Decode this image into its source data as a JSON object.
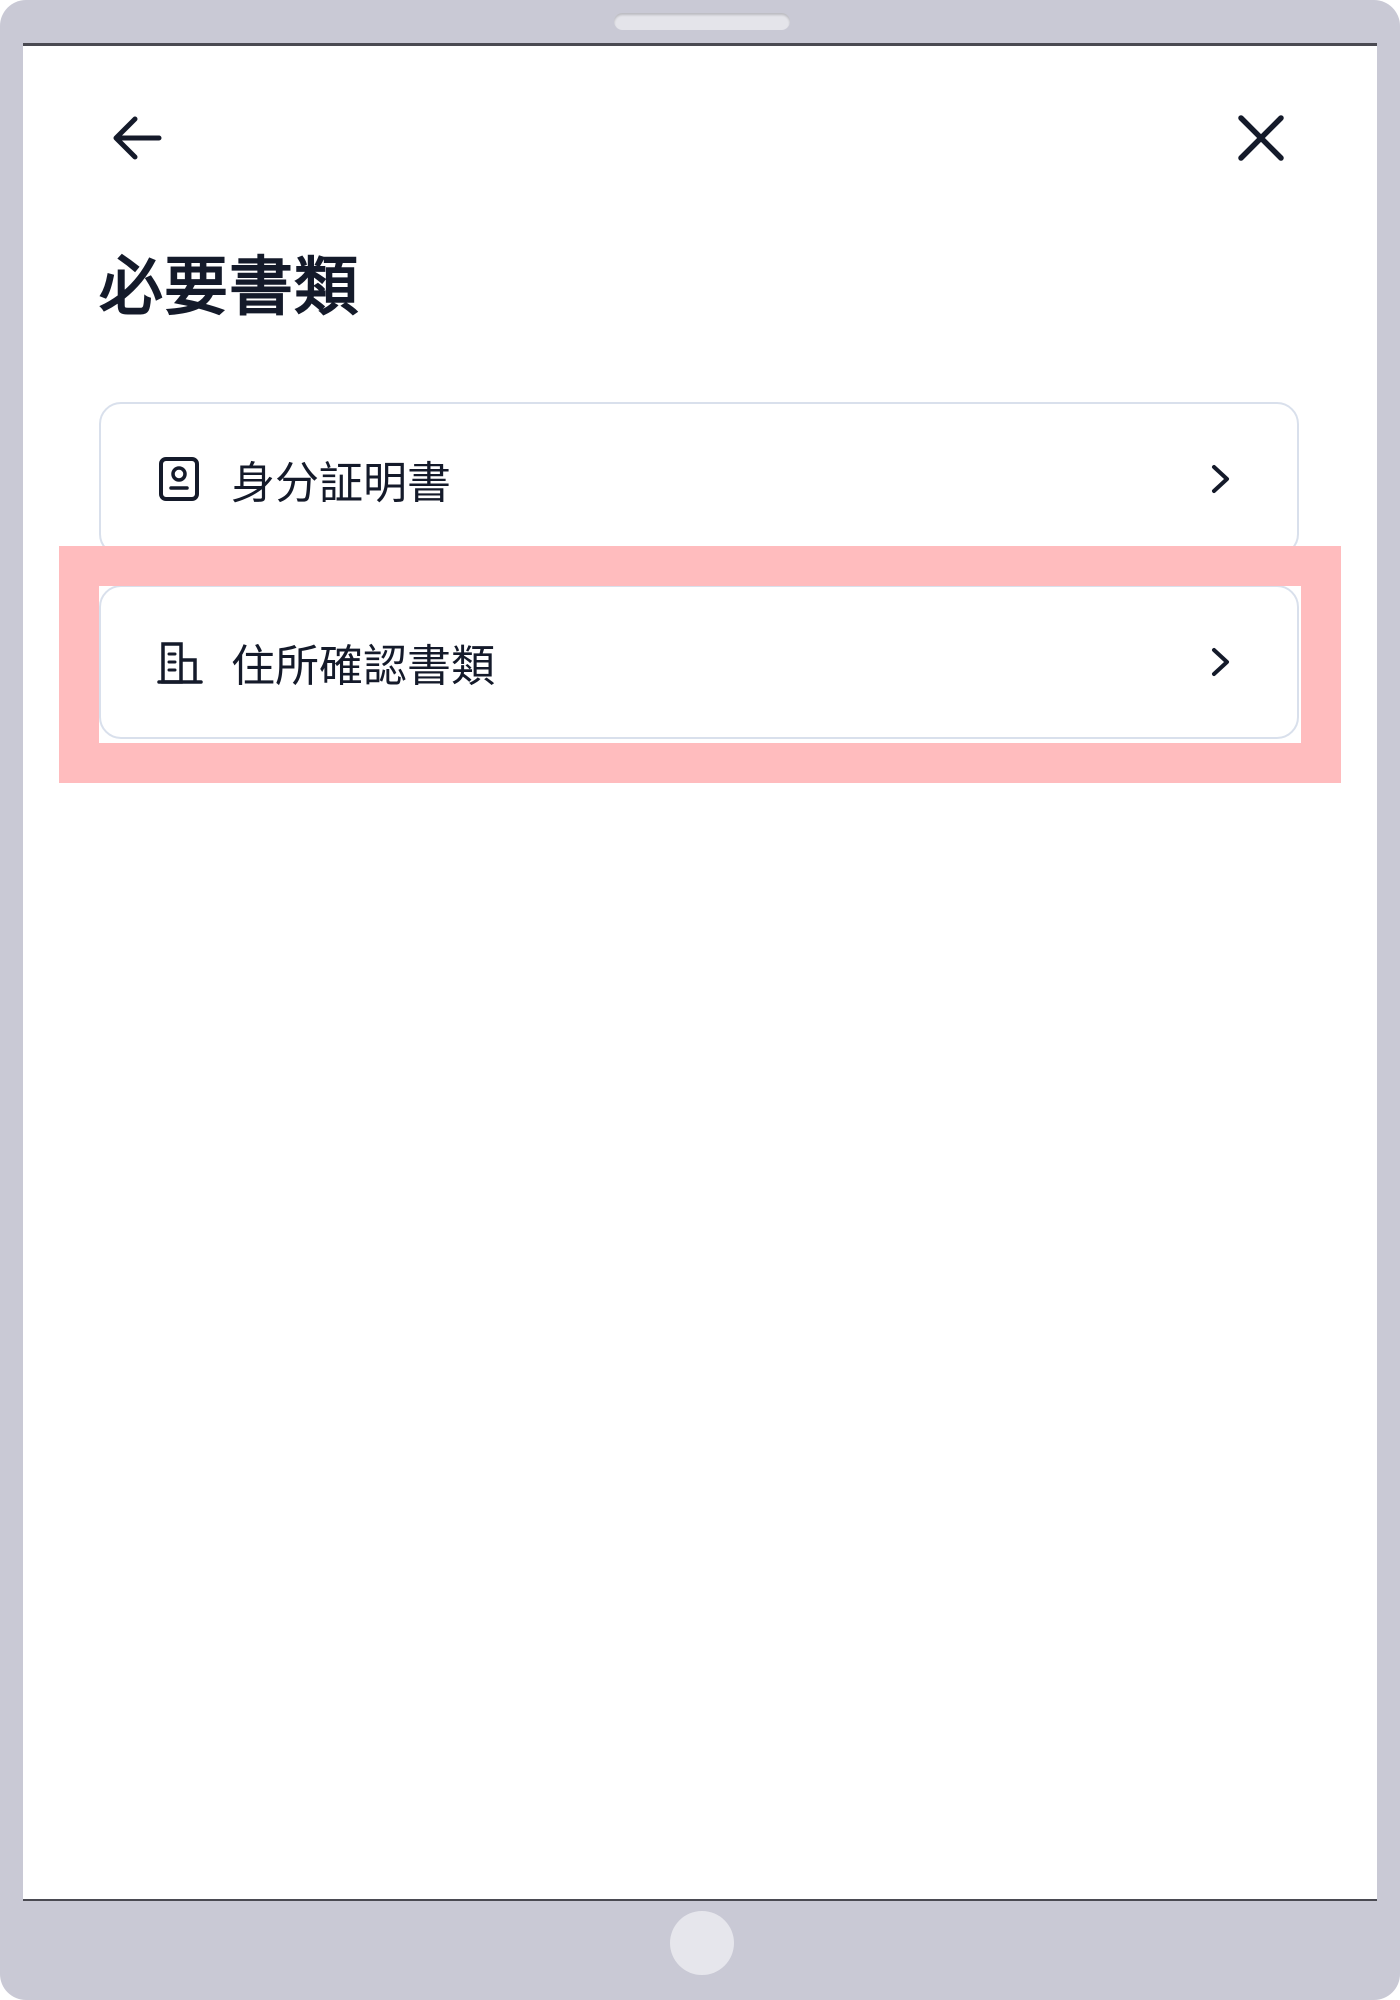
{
  "header": {
    "back_icon": "arrow-left-icon",
    "close_icon": "close-icon"
  },
  "page": {
    "title": "必要書類"
  },
  "documents": [
    {
      "label": "身分証明書",
      "icon": "id-card-icon",
      "chevron_icon": "chevron-right-icon"
    },
    {
      "label": "住所確認書類",
      "icon": "building-icon",
      "chevron_icon": "chevron-right-icon",
      "highlighted": true
    }
  ],
  "colors": {
    "text": "#141a2a",
    "card_border": "#d9e0ec",
    "highlight": "#ffbcbe",
    "device_frame": "#c9c9d5"
  }
}
